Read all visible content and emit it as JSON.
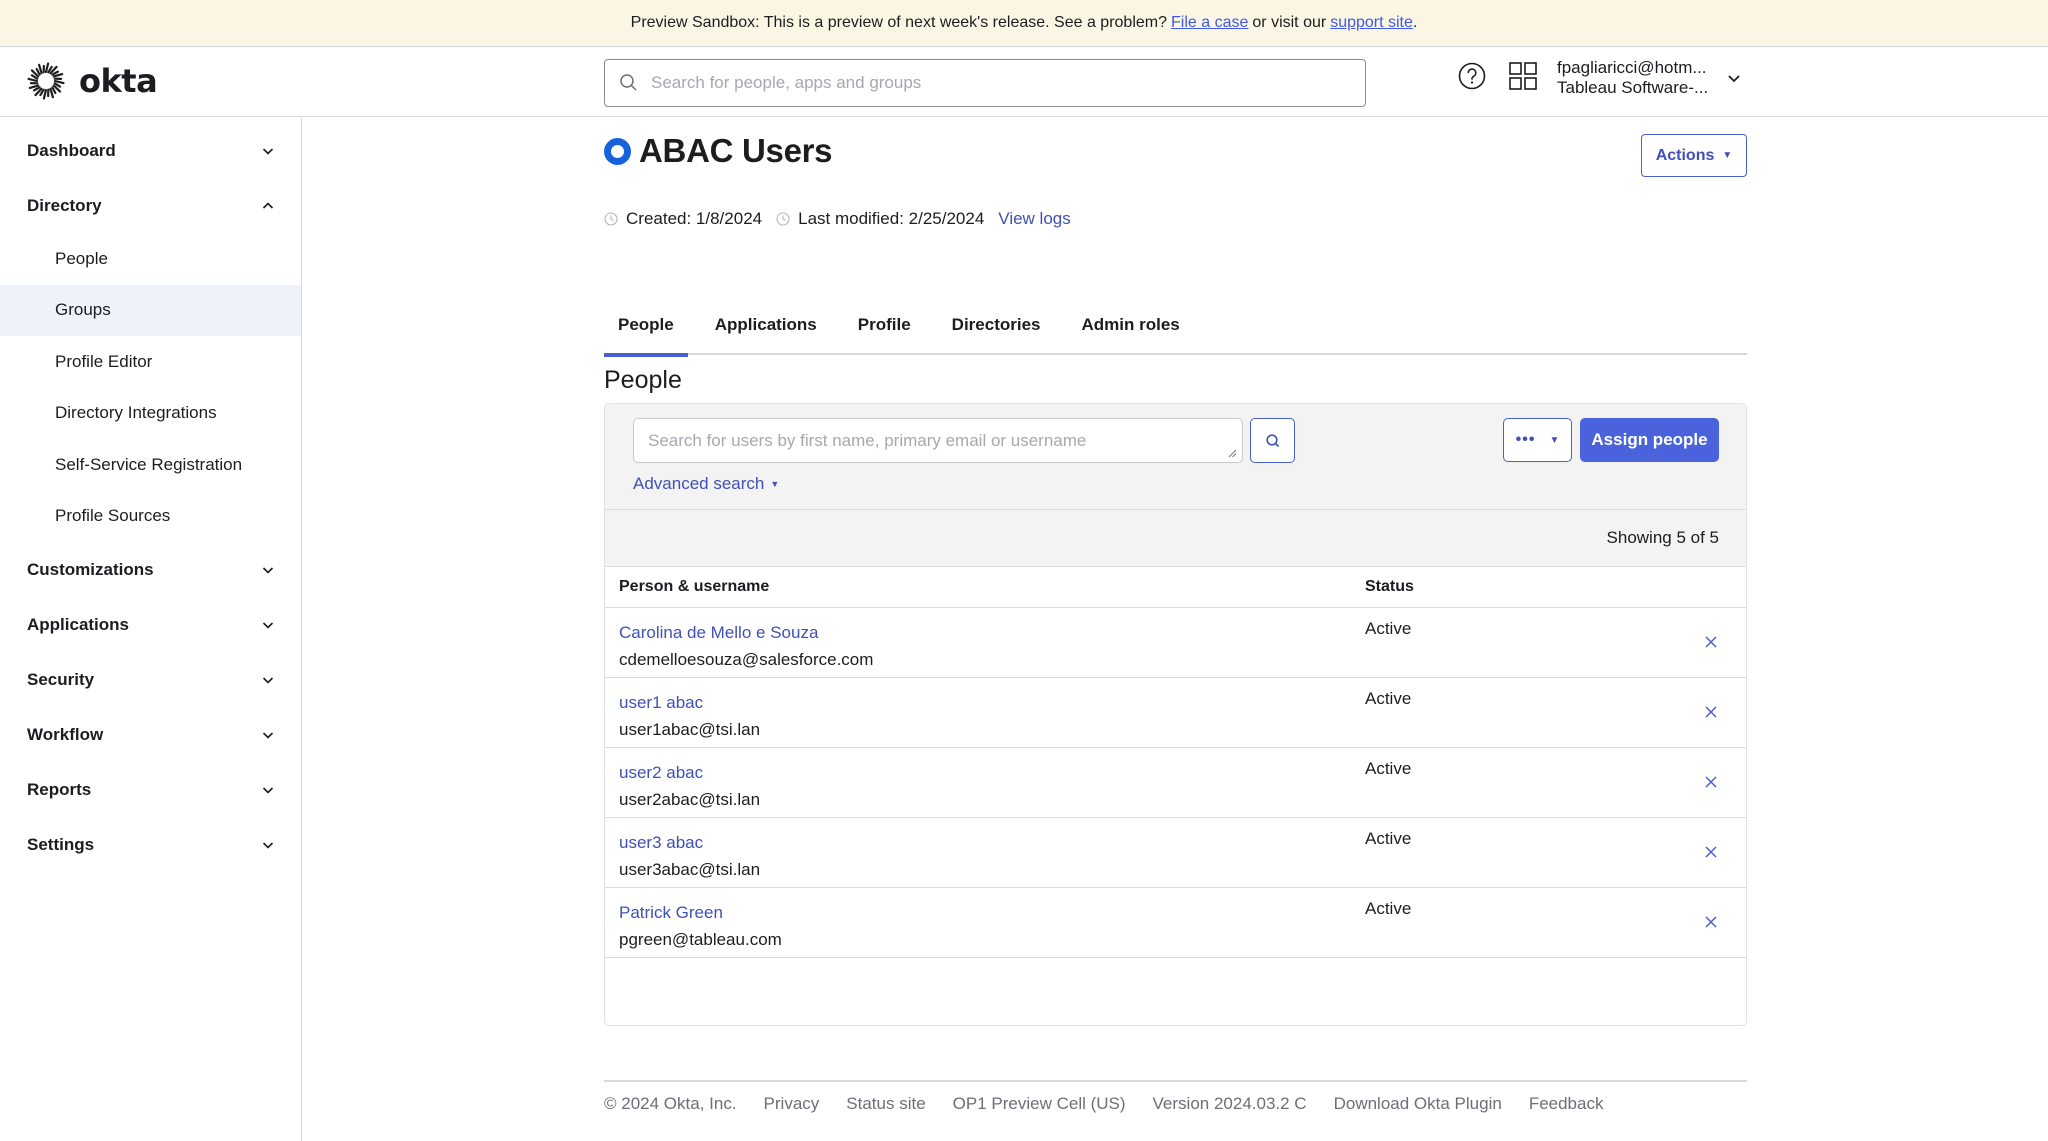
{
  "banner": {
    "text_before": "Preview Sandbox: This is a preview of next week's release. See a problem?",
    "file_case_link": "File a case",
    "text_middle": "or visit our",
    "support_link": "support site",
    "text_after": "."
  },
  "header": {
    "logo_text": "okta",
    "search_placeholder": "Search for people, apps and groups",
    "search_value": "",
    "help_icon": "help-circle-icon",
    "apps_icon": "app-grid-icon",
    "user_email": "fpagliaricci@hotm...",
    "user_org": "Tableau Software-..."
  },
  "sidebar": {
    "sections": [
      {
        "label": "Dashboard",
        "expanded": false
      },
      {
        "label": "Directory",
        "expanded": true,
        "items": [
          {
            "label": "People",
            "active": false
          },
          {
            "label": "Groups",
            "active": true
          },
          {
            "label": "Profile Editor",
            "active": false
          },
          {
            "label": "Directory Integrations",
            "active": false
          },
          {
            "label": "Self-Service Registration",
            "active": false
          },
          {
            "label": "Profile Sources",
            "active": false
          }
        ]
      },
      {
        "label": "Customizations",
        "expanded": false
      },
      {
        "label": "Applications",
        "expanded": false
      },
      {
        "label": "Security",
        "expanded": false
      },
      {
        "label": "Workflow",
        "expanded": false
      },
      {
        "label": "Reports",
        "expanded": false
      },
      {
        "label": "Settings",
        "expanded": false
      }
    ]
  },
  "group": {
    "title": "ABAC Users",
    "actions_label": "Actions",
    "created": "Created: 1/8/2024",
    "last_modified": "Last modified: 2/25/2024",
    "view_logs": "View logs"
  },
  "tabs": [
    {
      "label": "People",
      "active": true
    },
    {
      "label": "Applications",
      "active": false
    },
    {
      "label": "Profile",
      "active": false
    },
    {
      "label": "Directories",
      "active": false
    },
    {
      "label": "Admin roles",
      "active": false
    }
  ],
  "people": {
    "section_title": "People",
    "search_placeholder": "Search for users by first name, primary email or username",
    "search_value": "",
    "advanced_search": "Advanced search",
    "more_label": "•••",
    "assign_label": "Assign people",
    "showing": "Showing 5 of 5",
    "columns": {
      "person": "Person & username",
      "status": "Status"
    },
    "rows": [
      {
        "name": "Carolina de Mello e Souza",
        "email": "cdemelloesouza@salesforce.com",
        "status": "Active"
      },
      {
        "name": "user1 abac",
        "email": "user1abac@tsi.lan",
        "status": "Active"
      },
      {
        "name": "user2 abac",
        "email": "user2abac@tsi.lan",
        "status": "Active"
      },
      {
        "name": "user3 abac",
        "email": "user3abac@tsi.lan",
        "status": "Active"
      },
      {
        "name": "Patrick Green",
        "email": "pgreen@tableau.com",
        "status": "Active"
      }
    ]
  },
  "footer": {
    "items": [
      "© 2024 Okta, Inc.",
      "Privacy",
      "Status site",
      "OP1 Preview Cell (US)",
      "Version 2024.03.2 C",
      "Download Okta Plugin",
      "Feedback"
    ]
  },
  "colors": {
    "accent": "#4a5fcf",
    "primary_button": "#4a63dc",
    "link": "#3f51b5",
    "group_icon": "#1662dd",
    "banner_bg": "#fbf6e3",
    "active_nav_bg": "#eef2fb"
  }
}
